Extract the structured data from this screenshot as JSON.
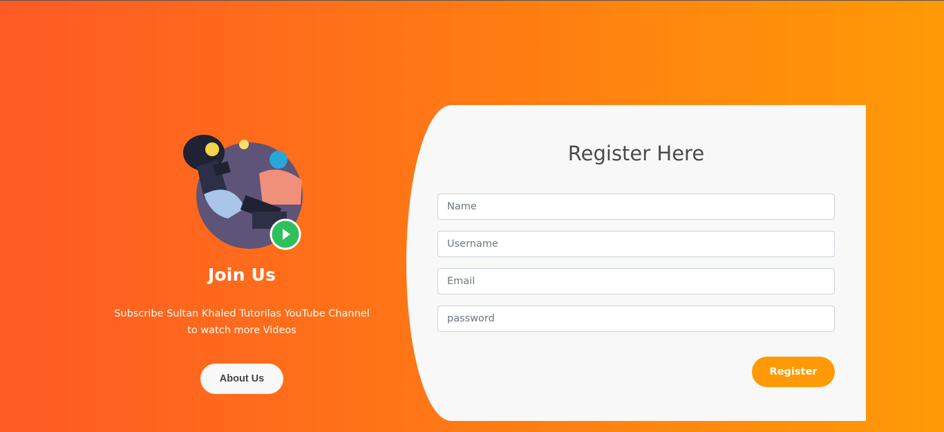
{
  "left": {
    "title": "Join Us",
    "subtitle": "Subscribe Sultan Khaled Tutorilas YouTube Channel to watch more Videos",
    "about_label": "About Us",
    "illustration": "people-collaborating-illustration",
    "play_icon": "play-icon"
  },
  "form": {
    "title": "Register Here",
    "fields": [
      {
        "placeholder": "Name"
      },
      {
        "placeholder": "Username"
      },
      {
        "placeholder": "Email"
      },
      {
        "placeholder": "password"
      }
    ],
    "submit_label": "Register"
  },
  "colors": {
    "gradient_start": "#ff5a24",
    "gradient_end": "#ff9a06",
    "accent": "#ff9a06",
    "play": "#2fbf5b"
  }
}
